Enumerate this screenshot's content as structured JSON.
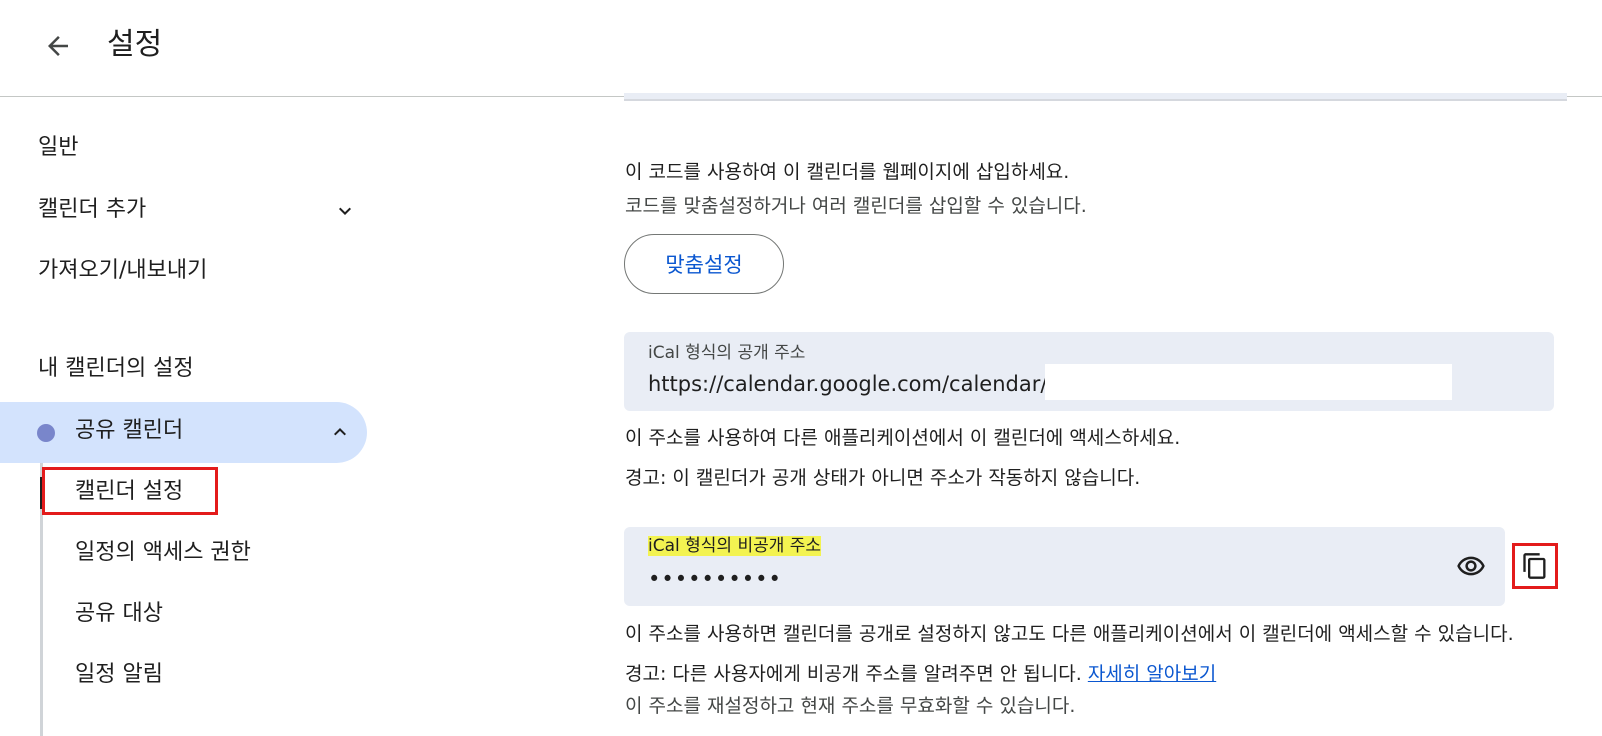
{
  "header": {
    "title": "설정",
    "back_icon": "arrow-back-icon"
  },
  "sidebar": {
    "general": "일반",
    "add_calendar": "캘린더 추가",
    "import_export": "가져오기/내보내기",
    "my_calendars_heading": "내 캘린더의 설정",
    "calendar": {
      "name": "공유 캘린더",
      "color": "#7986cb"
    },
    "sub_items": [
      "캘린더 설정",
      "일정의 액세스 권한",
      "공유 대상",
      "일정 알림"
    ]
  },
  "main": {
    "embed_line1": "이 코드를 사용하여 이 캘린더를 웹페이지에 삽입하세요.",
    "embed_line2": "코드를 맞춤설정하거나 여러 캘린더를 삽입할 수 있습니다.",
    "customize_button": "맞춤설정",
    "public_ical": {
      "label": "iCal 형식의 공개 주소",
      "value": "https://calendar.google.com/calendar/ical"
    },
    "public_note1": "이 주소를 사용하여 다른 애플리케이션에서 이 캘린더에 액세스하세요.",
    "public_note2": "경고: 이 캘린더가 공개 상태가 아니면 주소가 작동하지 않습니다.",
    "private_ical": {
      "label": "iCal 형식의 비공개 주소",
      "value": "••••••••••"
    },
    "private_note1": "이 주소를 사용하면 캘린더를 공개로 설정하지 않고도 다른 애플리케이션에서 이 캘린더에 액세스할 수 있습니다.",
    "private_note2": "경고: 다른 사용자에게 비공개 주소를 알려주면 안 됩니다.",
    "learn_more": "자세히 알아보기",
    "private_note3": "이 주소를 재설정하고 현재 주소를 무효화할 수 있습니다."
  },
  "colors": {
    "accent": "#0b57d0",
    "highlight": "#f3f351",
    "annotation": "#e31b1b",
    "selected_bg": "#d3e3fd"
  }
}
